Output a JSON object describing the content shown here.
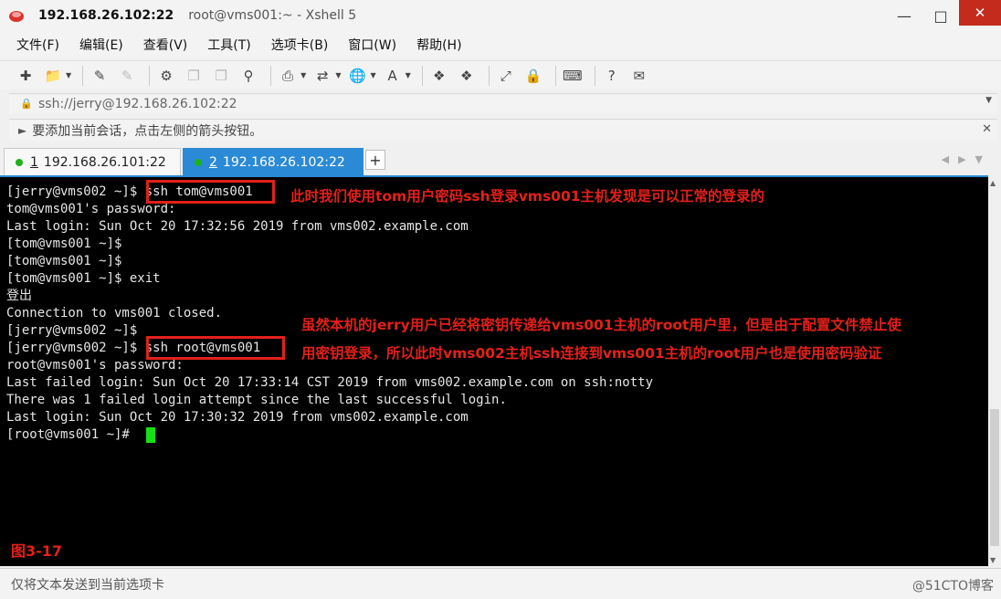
{
  "window": {
    "title_host": "192.168.26.102:22",
    "title_rest": "root@vms001:~ - Xshell 5"
  },
  "menu": [
    "文件(F)",
    "编辑(E)",
    "查看(V)",
    "工具(T)",
    "选项卡(B)",
    "窗口(W)",
    "帮助(H)"
  ],
  "address": {
    "text": "ssh://jerry@192.168.26.102:22"
  },
  "hint": {
    "text": "要添加当前会话，点击左侧的箭头按钮。"
  },
  "tabs": [
    {
      "num": "1",
      "label": "192.168.26.101:22"
    },
    {
      "num": "2",
      "label": "192.168.26.102:22"
    }
  ],
  "terminal": {
    "lines": [
      "[jerry@vms002 ~]$ ssh tom@vms001",
      "tom@vms001's password:",
      "Last login: Sun Oct 20 17:32:56 2019 from vms002.example.com",
      "[tom@vms001 ~]$",
      "[tom@vms001 ~]$",
      "[tom@vms001 ~]$ exit",
      "登出",
      "Connection to vms001 closed.",
      "[jerry@vms002 ~]$",
      "[jerry@vms002 ~]$ ssh root@vms001",
      "root@vms001's password:",
      "Last failed login: Sun Oct 20 17:33:14 CST 2019 from vms002.example.com on ssh:notty",
      "There was 1 failed login attempt since the last successful login.",
      "Last login: Sun Oct 20 17:30:32 2019 from vms002.example.com",
      "[root@vms001 ~]#"
    ],
    "annotations": [
      "此时我们使用tom用户密码ssh登录vms001主机发现是可以正常的登录的",
      "虽然本机的jerry用户已经将密钥传递给vms001主机的root用户里，但是由于配置文件禁止使",
      "用密钥登录，所以此时vms002主机ssh连接到vms001主机的root用户也是使用密码验证"
    ],
    "figure_label": "图3-17"
  },
  "status": {
    "text": "仅将文本发送到当前选项卡",
    "watermark": "@51CTO博客"
  }
}
